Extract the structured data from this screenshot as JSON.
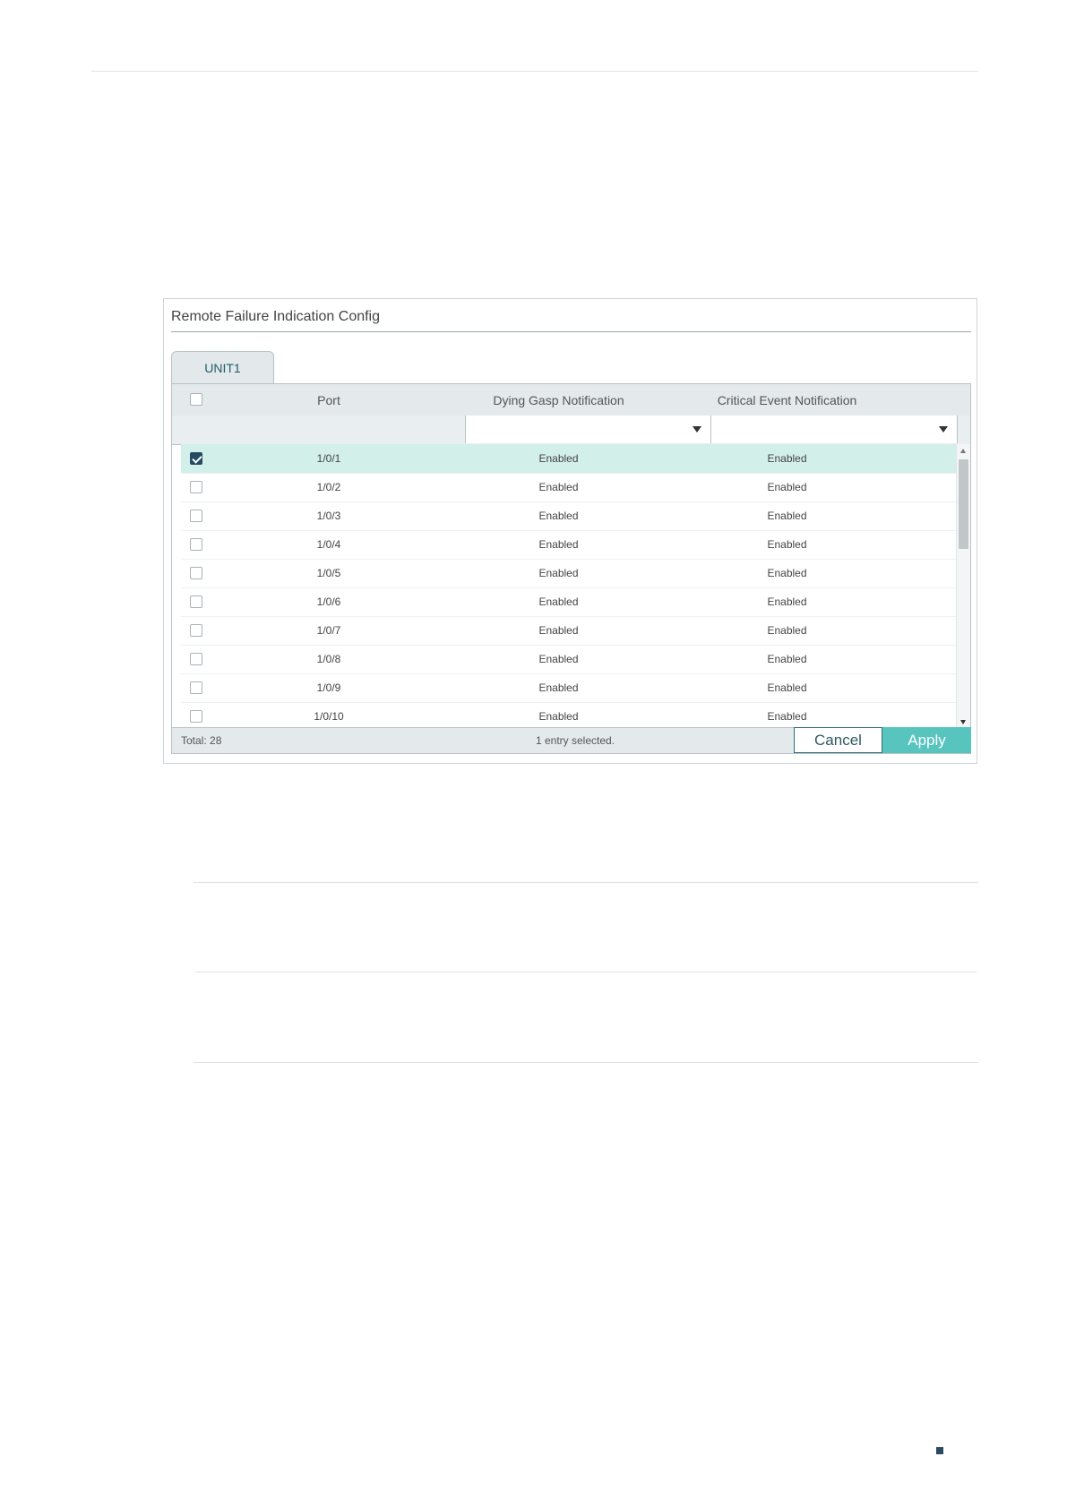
{
  "panel": {
    "title": "Remote Failure Indication Config",
    "tab_label": "UNIT1",
    "columns": {
      "port": "Port",
      "dying_gasp": "Dying Gasp Notification",
      "critical_event": "Critical Event Notification"
    },
    "filter": {
      "dying_gasp_value": "",
      "critical_event_value": ""
    },
    "rows": [
      {
        "port": "1/0/1",
        "dying_gasp": "Enabled",
        "critical_event": "Enabled",
        "checked": true
      },
      {
        "port": "1/0/2",
        "dying_gasp": "Enabled",
        "critical_event": "Enabled",
        "checked": false
      },
      {
        "port": "1/0/3",
        "dying_gasp": "Enabled",
        "critical_event": "Enabled",
        "checked": false
      },
      {
        "port": "1/0/4",
        "dying_gasp": "Enabled",
        "critical_event": "Enabled",
        "checked": false
      },
      {
        "port": "1/0/5",
        "dying_gasp": "Enabled",
        "critical_event": "Enabled",
        "checked": false
      },
      {
        "port": "1/0/6",
        "dying_gasp": "Enabled",
        "critical_event": "Enabled",
        "checked": false
      },
      {
        "port": "1/0/7",
        "dying_gasp": "Enabled",
        "critical_event": "Enabled",
        "checked": false
      },
      {
        "port": "1/0/8",
        "dying_gasp": "Enabled",
        "critical_event": "Enabled",
        "checked": false
      },
      {
        "port": "1/0/9",
        "dying_gasp": "Enabled",
        "critical_event": "Enabled",
        "checked": false
      },
      {
        "port": "1/0/10",
        "dying_gasp": "Enabled",
        "critical_event": "Enabled",
        "checked": false
      }
    ],
    "footer": {
      "total": "Total: 28",
      "selected": "1 entry selected.",
      "cancel_label": "Cancel",
      "apply_label": "Apply"
    }
  },
  "colors": {
    "selected_row": "#d3efea",
    "apply_button": "#57c4be",
    "checkbox_checked": "#244b63"
  }
}
